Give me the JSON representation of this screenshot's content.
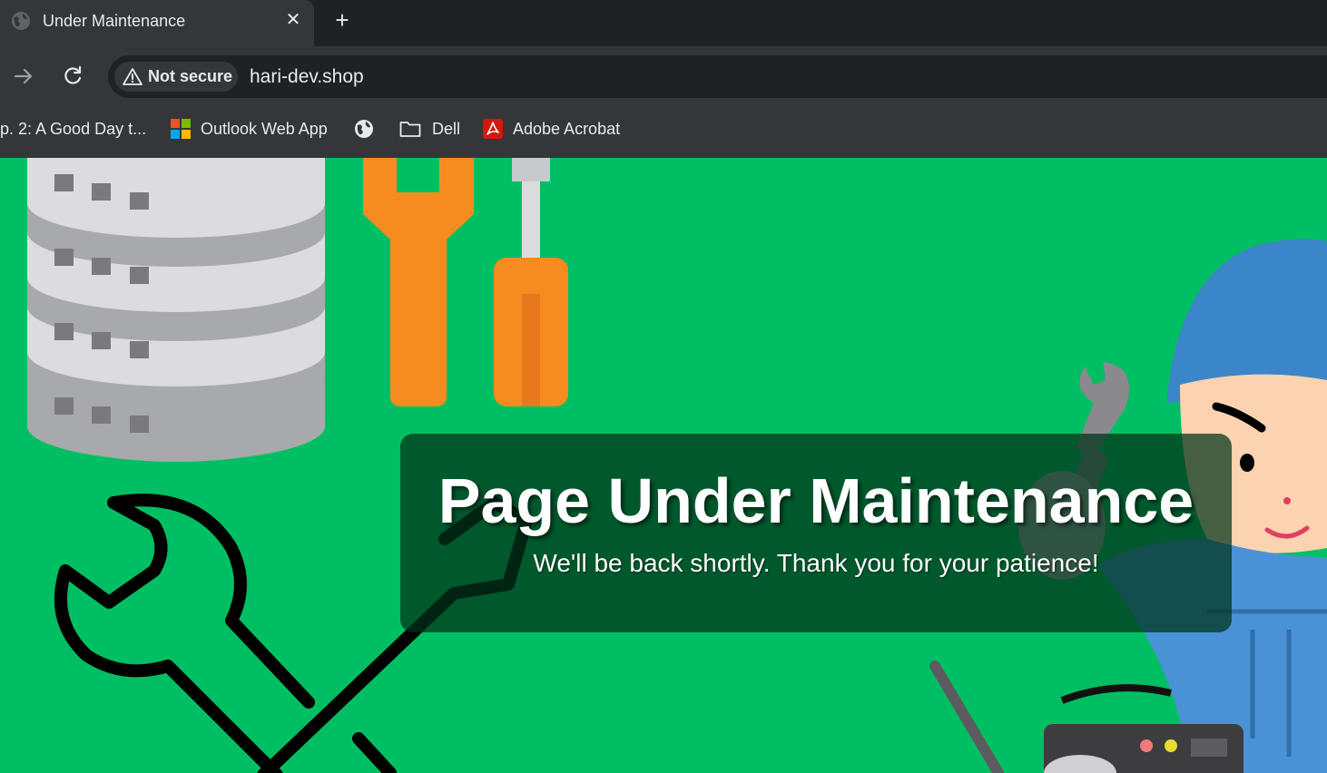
{
  "tab": {
    "title": "Under Maintenance",
    "close_glyph": "✕",
    "favicon": "globe-icon"
  },
  "new_tab_glyph": "+",
  "toolbar": {
    "forward_icon": "arrow-right-icon",
    "reload_icon": "reload-icon",
    "security_chip": "Not secure",
    "url": "hari-dev.shop"
  },
  "bookmarks": [
    {
      "label": "p. 2: A Good Day t...",
      "icon": ""
    },
    {
      "label": "Outlook Web App",
      "icon": "microsoft-logo-icon"
    },
    {
      "label": "",
      "icon": "globe-icon"
    },
    {
      "label": "Dell",
      "icon": "folder-icon"
    },
    {
      "label": "Adobe Acrobat",
      "icon": "acrobat-icon"
    }
  ],
  "page": {
    "background": "#00bf63",
    "heading": "Page Under Maintenance",
    "subheading": "We'll be back shortly. Thank you for your patience!"
  }
}
